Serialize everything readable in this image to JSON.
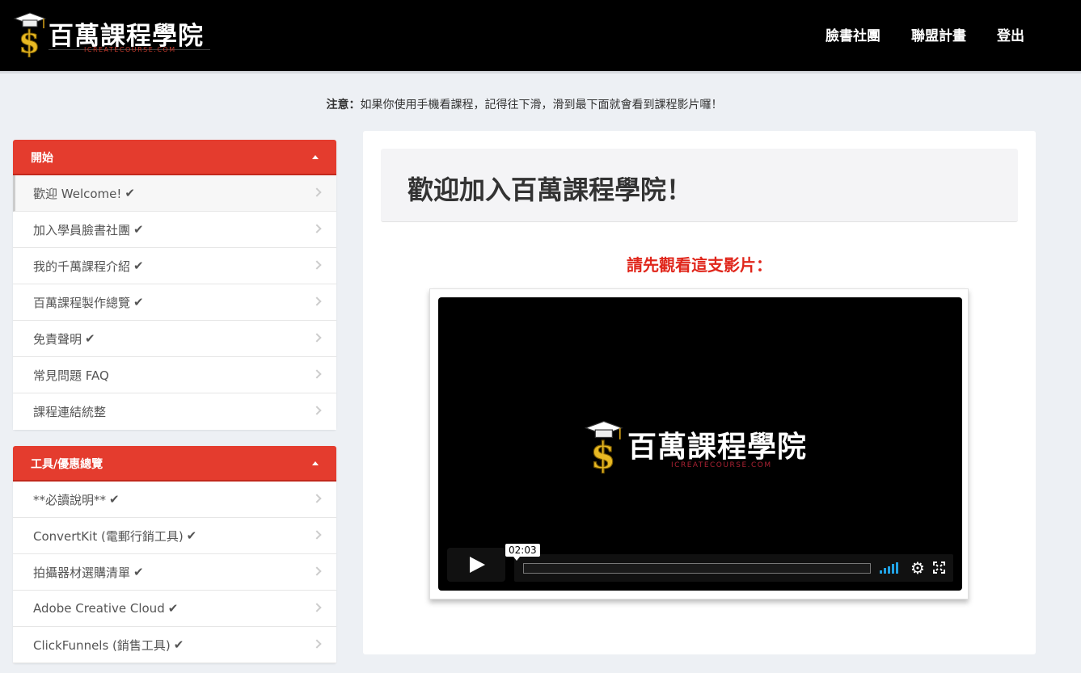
{
  "header": {
    "logo_text": "百萬課程學院",
    "logo_sub": "ICREATECOURSE.COM",
    "nav": [
      "臉書社團",
      "聯盟計畫",
      "登出"
    ]
  },
  "notice": {
    "label": "注意：",
    "text": "如果你使用手機看課程，記得往下滑，滑到最下面就會看到課程影片囉！"
  },
  "sidebar": {
    "sections": [
      {
        "title": "開始",
        "items": [
          {
            "label": "歡迎 Welcome!",
            "check": "✔"
          },
          {
            "label": "加入學員臉書社團",
            "check": "✔"
          },
          {
            "label": "我的千萬課程介紹",
            "check": "✔"
          },
          {
            "label": "百萬課程製作總覽",
            "check": "✔"
          },
          {
            "label": "免責聲明",
            "check": "✔"
          },
          {
            "label": "常見問題 FAQ",
            "check": ""
          },
          {
            "label": "課程連結統整",
            "check": ""
          }
        ]
      },
      {
        "title": "工具/優惠總覽",
        "items": [
          {
            "label": "**必讀說明**",
            "check": "✔"
          },
          {
            "label": "ConvertKit (電郵行銷工具)",
            "check": "✔"
          },
          {
            "label": "拍攝器材選購清單",
            "check": "✔"
          },
          {
            "label": "Adobe Creative Cloud",
            "check": "✔"
          },
          {
            "label": "ClickFunnels (銷售工具)",
            "check": "✔"
          }
        ]
      }
    ]
  },
  "main": {
    "title": "歡迎加入百萬課程學院！",
    "subtitle": "請先觀看這支影片：",
    "video": {
      "logo_text": "百萬課程學院",
      "logo_sub": "ICREATECOURSE.COM",
      "time": "02:03",
      "progress": 0
    }
  },
  "colors": {
    "accent": "#e43c2e",
    "subtitle": "#e0261b",
    "volume": "#21a3e6"
  }
}
